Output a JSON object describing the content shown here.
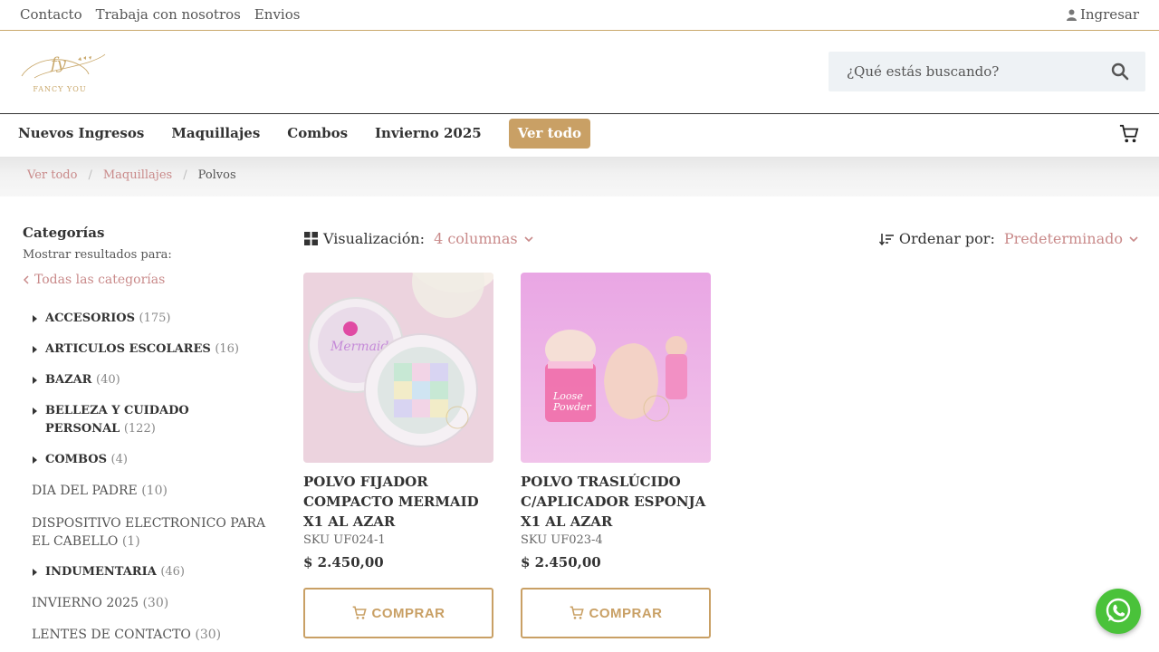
{
  "topbar": {
    "links": [
      "Contacto",
      "Trabaja con nosotros",
      "Envios"
    ],
    "login_label": "Ingresar"
  },
  "header": {
    "logo_text": "FANCY YOU",
    "search_placeholder": "¿Qué estás buscando?"
  },
  "nav": {
    "items": [
      "Nuevos Ingresos",
      "Maquillajes",
      "Combos",
      "Invierno 2025"
    ],
    "cta_label": "Ver todo"
  },
  "breadcrumb": {
    "items": [
      "Ver todo",
      "Maquillajes"
    ],
    "current": "Polvos"
  },
  "sidebar": {
    "title": "Categorías",
    "subtitle": "Mostrar resultados para:",
    "all_label": "Todas las categorías",
    "categories": [
      {
        "name": "ACCESORIOS",
        "count": "(175)"
      },
      {
        "name": "ARTICULOS ESCOLARES",
        "count": "(16)"
      },
      {
        "name": "BAZAR",
        "count": "(40)"
      },
      {
        "name": "BELLEZA Y CUIDADO PERSONAL",
        "count": "(122)"
      },
      {
        "name": "COMBOS",
        "count": "(4)"
      },
      {
        "name": "DIA DEL PADRE",
        "count": "(10)"
      },
      {
        "name": "DISPOSITIVO ELECTRONICO PARA EL CABELLO",
        "count": "(1)"
      },
      {
        "name": "INDUMENTARIA",
        "count": "(46)"
      },
      {
        "name": "INVIERNO 2025",
        "count": "(30)"
      },
      {
        "name": "LENTES DE CONTACTO",
        "count": "(30)"
      }
    ]
  },
  "toolbar": {
    "view_label": "Visualización:",
    "view_value": "4 columnas",
    "sort_label": "Ordenar por:",
    "sort_value": "Predeterminado"
  },
  "products": [
    {
      "name": "POLVO FIJADOR COMPACTO MERMAID X1 AL AZAR",
      "sku": "SKU UF024-1",
      "price": "$  2.450,00",
      "buy_label": "COMPRAR"
    },
    {
      "name": "POLVO TRASLÚCIDO C/APLICADOR ESPONJA X1 AL AZAR",
      "sku": "SKU UF023-4",
      "price": "$  2.450,00",
      "buy_label": "COMPRAR"
    }
  ],
  "colors": {
    "accent_gold": "#c9a065",
    "link_pink": "#c98a8a",
    "whatsapp_green": "#4ac23a"
  }
}
